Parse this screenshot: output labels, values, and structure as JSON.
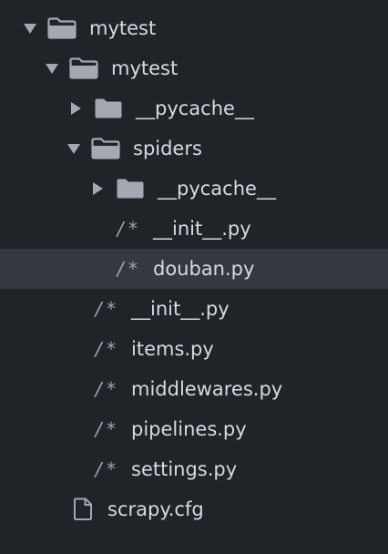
{
  "tree": [
    {
      "label": "mytest",
      "type": "folder",
      "state": "open",
      "depth": 0
    },
    {
      "label": "mytest",
      "type": "folder",
      "state": "open",
      "depth": 1
    },
    {
      "label": "__pycache__",
      "type": "folder",
      "state": "closed",
      "depth": 2
    },
    {
      "label": "spiders",
      "type": "folder",
      "state": "open",
      "depth": 2
    },
    {
      "label": "__pycache__",
      "type": "folder",
      "state": "closed",
      "depth": 3
    },
    {
      "label": "__init__.py",
      "type": "python-file",
      "depth": 3
    },
    {
      "label": "douban.py",
      "type": "python-file",
      "depth": 3,
      "selected": true
    },
    {
      "label": "__init__.py",
      "type": "python-file",
      "depth": 2
    },
    {
      "label": "items.py",
      "type": "python-file",
      "depth": 2
    },
    {
      "label": "middlewares.py",
      "type": "python-file",
      "depth": 2
    },
    {
      "label": "pipelines.py",
      "type": "python-file",
      "depth": 2
    },
    {
      "label": "settings.py",
      "type": "python-file",
      "depth": 2
    },
    {
      "label": "scrapy.cfg",
      "type": "file",
      "depth": 1
    }
  ],
  "icons": {
    "python_file_glyph": "/*"
  },
  "colors": {
    "background": "#202328",
    "selected_row": "#343941",
    "text": "#d7dae0",
    "icon": "#9da2ab"
  }
}
